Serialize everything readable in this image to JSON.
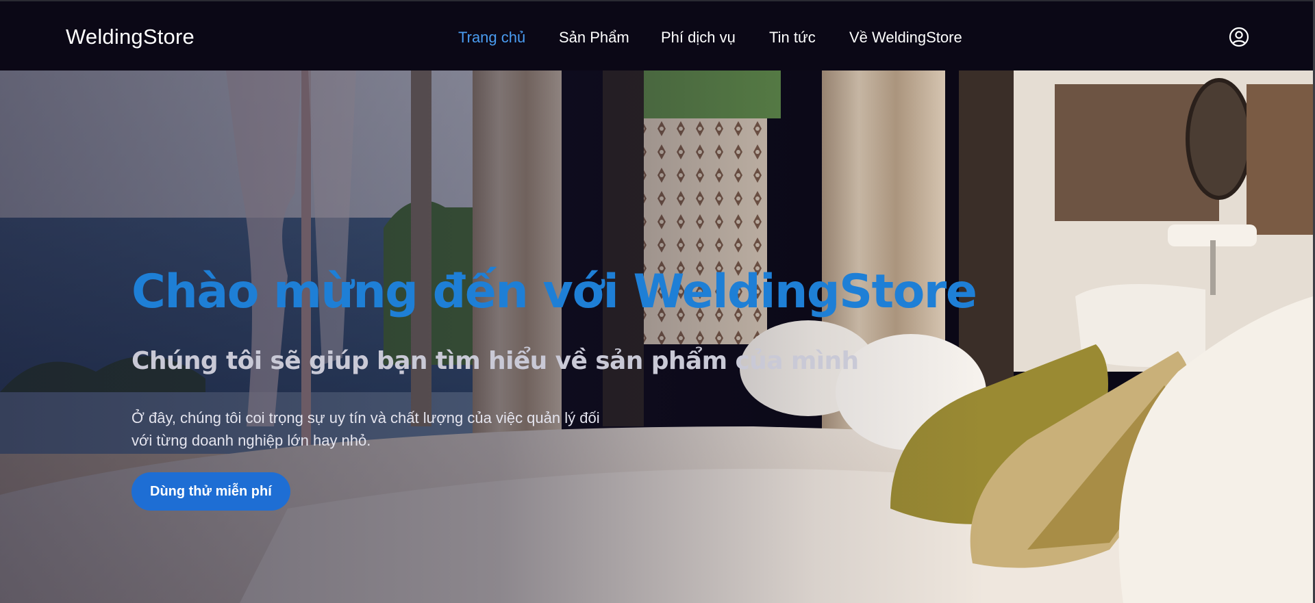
{
  "header": {
    "brand": "WeldingStore",
    "nav": [
      {
        "label": "Trang chủ",
        "active": true
      },
      {
        "label": "Sản Phẩm",
        "active": false
      },
      {
        "label": "Phí dịch vụ",
        "active": false
      },
      {
        "label": "Tin tức",
        "active": false
      },
      {
        "label": "Về WeldingStore",
        "active": false
      }
    ],
    "user_icon": "user-circle-icon"
  },
  "hero": {
    "title": "Chào mừng đến với WeldingStore",
    "subtitle": "Chúng tôi sẽ giúp bạn tìm hiểu về sản phẩm của mình",
    "description": "Ở đây, chúng tôi coi trọng sự uy tín và chất lượng của việc quản lý đối với từng doanh nghiệp lớn hay nhỏ.",
    "cta_label": "Dùng thử miễn phí",
    "background_image": "resort-bedroom-ocean-view"
  },
  "colors": {
    "header_bg": "#0b0816",
    "accent": "#1e7fd6",
    "nav_active": "#4a9cf0",
    "cta_bg": "#1e6ed4"
  }
}
